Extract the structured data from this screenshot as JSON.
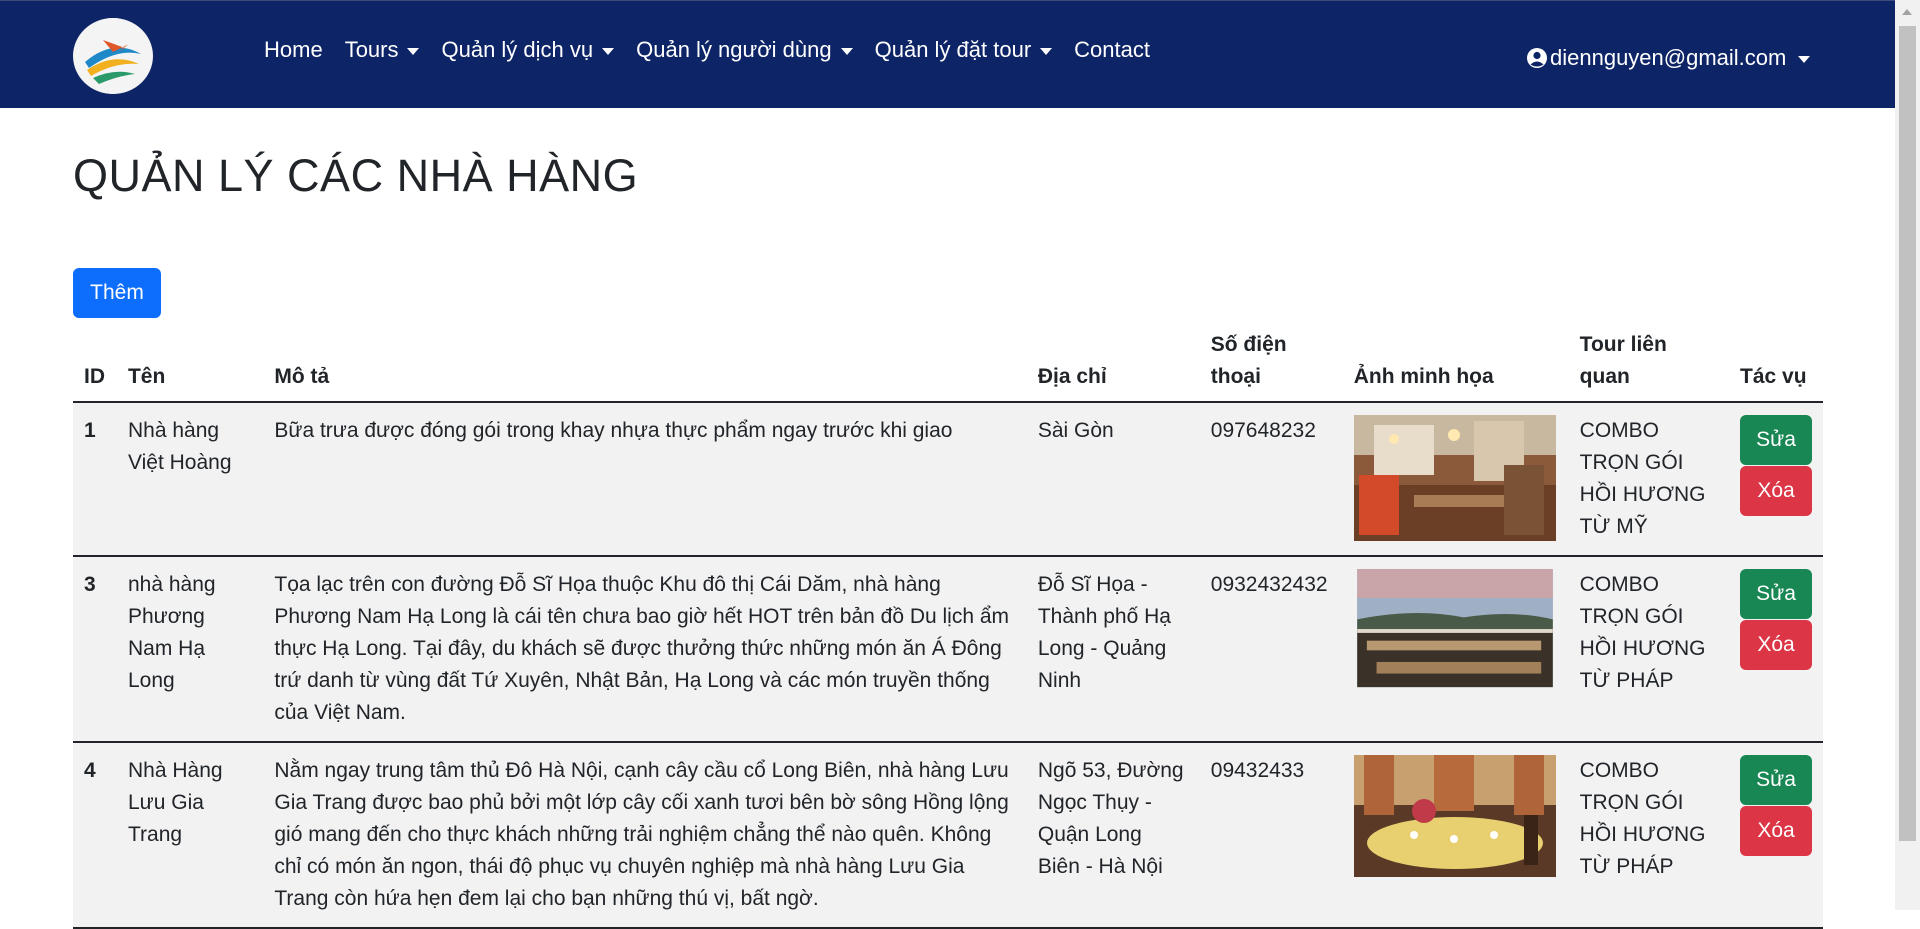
{
  "navbar": {
    "links": [
      {
        "label": "Home",
        "dropdown": false
      },
      {
        "label": "Tours",
        "dropdown": true
      },
      {
        "label": "Quản lý dịch vụ",
        "dropdown": true
      },
      {
        "label": "Quản lý người dùng",
        "dropdown": true
      },
      {
        "label": "Quản lý đặt tour",
        "dropdown": true
      },
      {
        "label": "Contact",
        "dropdown": false
      }
    ],
    "user_email": "diennguyen@gmail.com"
  },
  "page": {
    "title": "QUẢN LÝ CÁC NHÀ HÀNG",
    "add_button": "Thêm"
  },
  "table": {
    "headers": {
      "id": "ID",
      "name": "Tên",
      "description": "Mô tả",
      "address": "Địa chỉ",
      "phone": "Số điện thoại",
      "image": "Ảnh minh họa",
      "tour": "Tour liên quan",
      "actions": "Tác vụ"
    },
    "edit_label": "Sửa",
    "delete_label": "Xóa",
    "rows": [
      {
        "id": "1",
        "name": "Nhà hàng Việt Hoàng",
        "description": "Bữa trưa được đóng gói trong khay nhựa thực phẩm ngay trước khi giao",
        "address": "Sài Gòn",
        "phone": "097648232",
        "image_icon": "restaurant-interior-photo",
        "tour": "COMBO TRỌN GÓI HỒI HƯƠNG TỪ MỸ"
      },
      {
        "id": "3",
        "name": "nhà hàng Phương Nam Hạ Long",
        "description": "Tọa lạc trên con đường Đỗ Sĩ Họa thuộc Khu đô thị Cái Dăm, nhà hàng Phương Nam Hạ Long là cái tên chưa bao giờ hết HOT trên bản đồ Du lịch ẩm thực Hạ Long. Tại đây, du khách sẽ được thưởng thức những món ăn Á Đông trứ danh từ vùng đất Tứ Xuyên, Nhật Bản, Hạ Long và các món truyền thống của Việt Nam.",
        "address": "Đỗ Sĩ Họa - Thành phố Hạ Long - Quảng Ninh",
        "phone": "0932432432",
        "image_icon": "restaurant-terrace-photo",
        "tour": "COMBO TRỌN GÓI HỒI HƯƠNG TỪ PHÁP"
      },
      {
        "id": "4",
        "name": "Nhà Hàng Lưu Gia Trang",
        "description": "Nằm ngay trung tâm thủ Đô Hà Nội, cạnh cây cầu cổ Long Biên, nhà hàng Lưu Gia Trang được bao phủ bởi một lớp cây cối xanh tươi bên bờ sông Hồng lộng gió mang đến cho thực khách những trải nghiệm chẳng thể nào quên. Không chỉ có món ăn ngon, thái độ phục vụ chuyên nghiệp mà nhà hàng Lưu Gia Trang còn hứa hẹn đem lại cho bạn những thú vị, bất ngờ.",
        "address": "Ngõ 53, Đường Ngọc Thụy - Quận Long Biên - Hà Nội",
        "phone": "09432433",
        "image_icon": "banquet-table-photo",
        "tour": "COMBO TRỌN GÓI HỒI HƯƠNG TỪ PHÁP"
      }
    ]
  }
}
